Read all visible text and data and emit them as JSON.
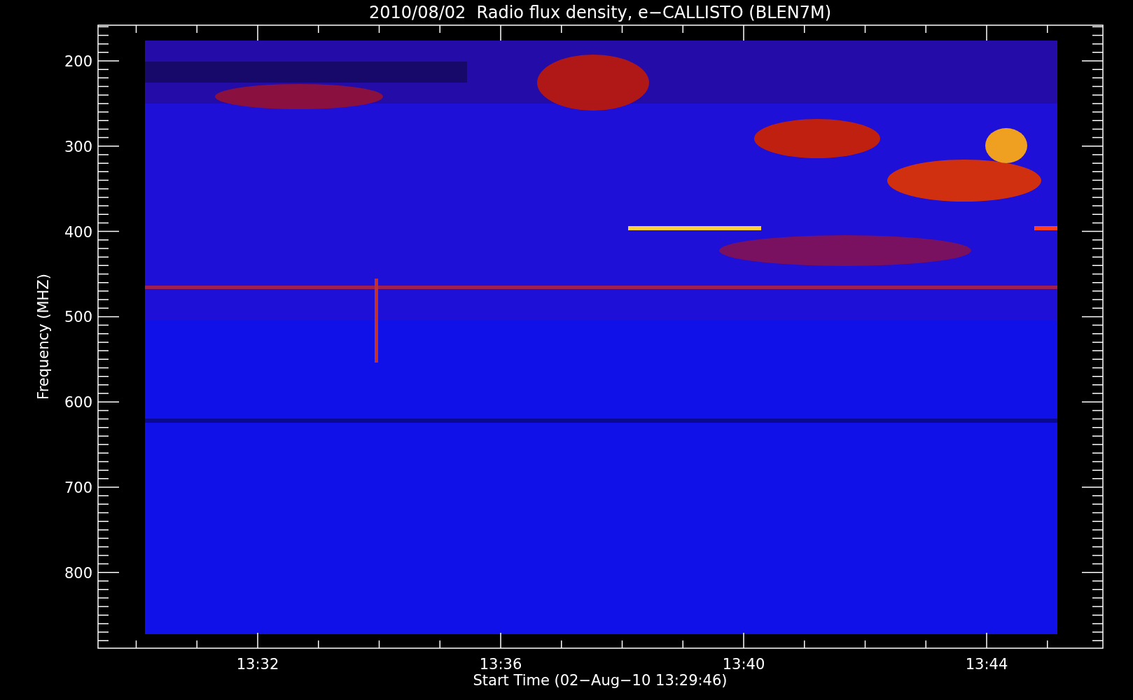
{
  "title": "2010/08/02  Radio flux density, e−CALLISTO (BLEN7M)",
  "y_axis": {
    "label": "Frequency (MHZ)",
    "ticks": [
      "200",
      "300",
      "400",
      "500",
      "600",
      "700",
      "800"
    ]
  },
  "x_axis": {
    "label": "Start Time (02−Aug−10 13:29:46)",
    "ticks": [
      "13:32",
      "13:36",
      "13:40",
      "13:44"
    ]
  }
}
